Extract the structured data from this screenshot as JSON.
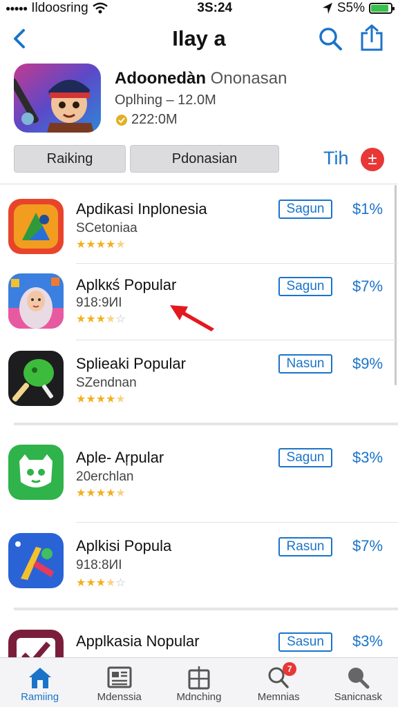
{
  "status_bar": {
    "carrier": "Ildoosring",
    "time": "3S:24",
    "battery_text": "S5%",
    "battery_level": 0.9
  },
  "nav": {
    "title": "Ilay a",
    "back_icon": "chevron-left-icon",
    "search_icon": "search-icon",
    "share_icon": "share-icon"
  },
  "hero": {
    "title_strong": "Adoonedàn",
    "title_muted": "Ononasan",
    "meta1": "Oplhing – 12.0M",
    "meta2": "222:0M",
    "badge_icon": "award-icon"
  },
  "segments": {
    "seg1": "Raiking",
    "seg2": "Pdonasian",
    "tih": "Tih",
    "plus": "±"
  },
  "apps": [
    {
      "name": "Apdikasi Inplonesia",
      "sub": "SCetoniaa",
      "rating": 4.5,
      "button": "Sagun",
      "price": "$1%"
    },
    {
      "name": "Aplkкś Popular",
      "sub": "918:9ИI",
      "rating": 3.5,
      "button": "Sagun",
      "price": "$7%"
    },
    {
      "name": "Splieaki Popular",
      "sub": "SZendnan",
      "rating": 4.5,
      "button": "Nasun",
      "price": "$9%"
    },
    {
      "name": "Aple- Aŗpular",
      "sub": "20erchlan",
      "rating": 4.5,
      "button": "Sagun",
      "price": "$3%"
    },
    {
      "name": "Aplkisi Popula",
      "sub": "918:8ИI",
      "rating": 3.5,
      "button": "Rasun",
      "price": "$7%"
    },
    {
      "name": "Applkasia Nopular",
      "sub": "",
      "rating": 0,
      "button": "Sasun",
      "price": "$3%"
    }
  ],
  "tabs": [
    {
      "label": "Ramiing",
      "icon": "home-icon",
      "active": true
    },
    {
      "label": "Mdenssia",
      "icon": "news-icon",
      "active": false
    },
    {
      "label": "Mdnching",
      "icon": "calendar-icon",
      "active": false
    },
    {
      "label": "Memnias",
      "icon": "search-icon",
      "active": false,
      "badge": "7"
    },
    {
      "label": "Sanicnask",
      "icon": "magnifier-icon",
      "active": false
    }
  ],
  "colors": {
    "accent": "#1b73c9",
    "badge": "#e83737",
    "star": "#f2b01e"
  }
}
